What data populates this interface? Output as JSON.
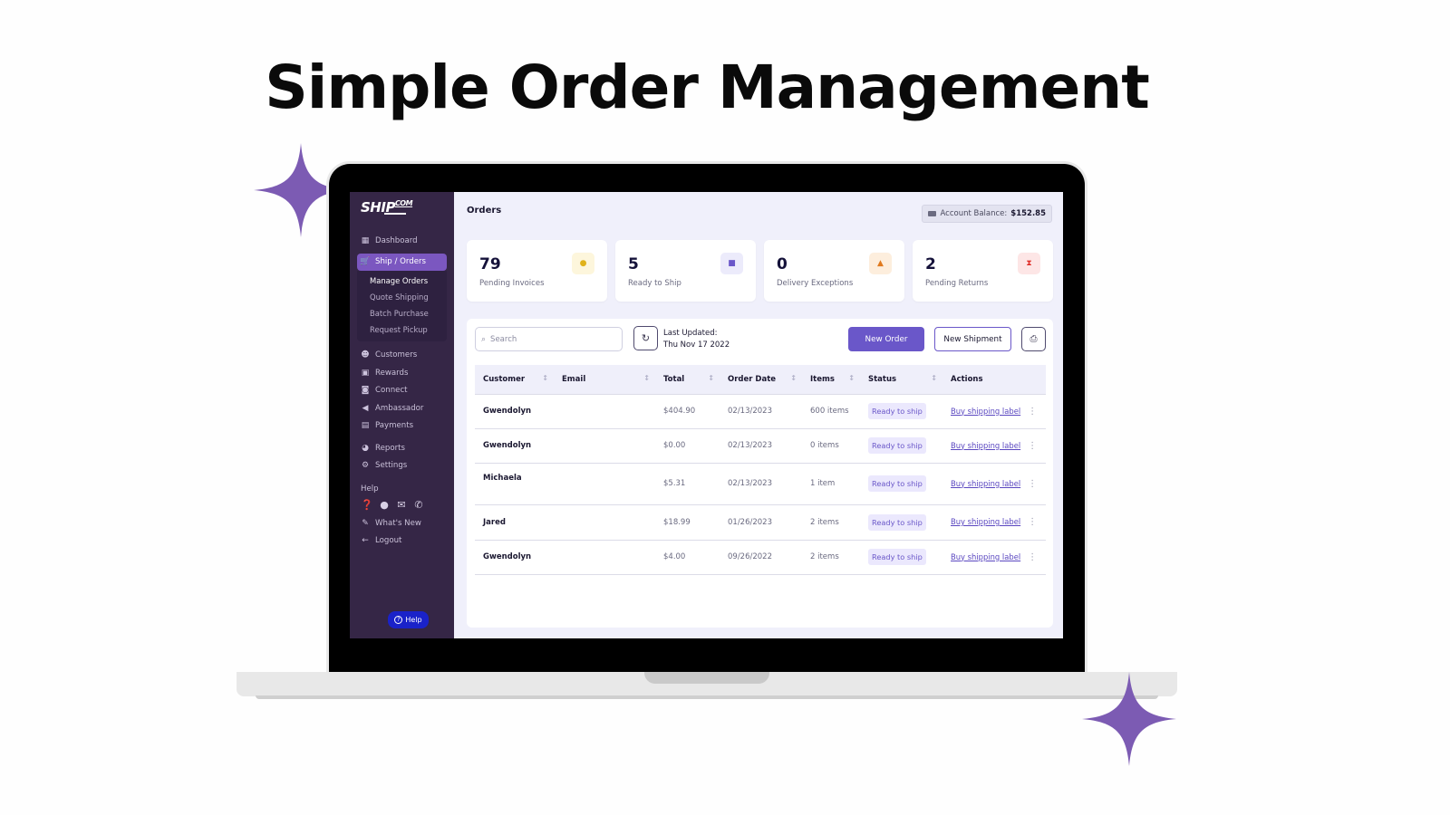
{
  "hero": {
    "title": "Simple Order Management"
  },
  "colors": {
    "accent": "#6a57c9",
    "sidebar_bg": "#352646",
    "sparkle": "#7c5bb3",
    "help_button": "#1a22c9"
  },
  "sidebar": {
    "logo": {
      "main": "SHIP",
      "sub": "COM"
    },
    "items": [
      {
        "label": "Dashboard",
        "icon": "grid-icon",
        "glyph": "▦"
      },
      {
        "label": "Ship / Orders",
        "icon": "cart-icon",
        "glyph": "🛒",
        "active": true
      },
      {
        "label": "Customers",
        "icon": "users-icon",
        "glyph": "👥"
      },
      {
        "label": "Rewards",
        "icon": "gift-icon",
        "glyph": "🎁"
      },
      {
        "label": "Connect",
        "icon": "chat-icon",
        "glyph": "💬"
      },
      {
        "label": "Ambassador",
        "icon": "megaphone-icon",
        "glyph": "📣"
      },
      {
        "label": "Payments",
        "icon": "money-icon",
        "glyph": "💵"
      },
      {
        "label": "Reports",
        "icon": "pie-chart-icon",
        "glyph": "◕"
      },
      {
        "label": "Settings",
        "icon": "gear-icon",
        "glyph": "⚙"
      }
    ],
    "subitems": [
      {
        "label": "Manage Orders",
        "current": true
      },
      {
        "label": "Quote Shipping"
      },
      {
        "label": "Batch Purchase"
      },
      {
        "label": "Request Pickup"
      }
    ],
    "help_heading": "Help",
    "help_icons": [
      {
        "name": "question-icon",
        "glyph": "❓"
      },
      {
        "name": "chat-bubble-icon",
        "glyph": "💬"
      },
      {
        "name": "envelope-icon",
        "glyph": "✉"
      },
      {
        "name": "phone-icon",
        "glyph": "✆"
      }
    ],
    "whats_new": {
      "label": "What's New",
      "glyph": "✎"
    },
    "logout": {
      "label": "Logout",
      "glyph": "←"
    },
    "help_button": "Help"
  },
  "header": {
    "title": "Orders",
    "balance_label": "Account Balance:",
    "balance_value": "$152.85"
  },
  "stats": [
    {
      "value": "79",
      "label": "Pending Invoices",
      "icon": "clock-icon",
      "glyph": "●",
      "bg": "#fdf6dc",
      "fg": "#e0b21a"
    },
    {
      "value": "5",
      "label": "Ready to Ship",
      "icon": "cart-icon",
      "glyph": "🛒",
      "bg": "#ecebfb",
      "fg": "#6a57c9"
    },
    {
      "value": "0",
      "label": "Delivery Exceptions",
      "icon": "warning-icon",
      "glyph": "▲",
      "bg": "#fdeedd",
      "fg": "#e07a1f"
    },
    {
      "value": "2",
      "label": "Pending Returns",
      "icon": "hourglass-icon",
      "glyph": "⧗",
      "bg": "#fde6e6",
      "fg": "#e0352f"
    }
  ],
  "toolbar": {
    "search_placeholder": "Search",
    "last_updated_label": "Last Updated:",
    "last_updated_value": "Thu Nov 17 2022",
    "new_order": "New Order",
    "new_shipment": "New Shipment"
  },
  "table": {
    "columns": [
      "Customer",
      "Email",
      "Total",
      "Order Date",
      "Items",
      "Status",
      "Actions"
    ],
    "rows": [
      {
        "customer": "Gwendolyn",
        "email": "",
        "total": "$404.90",
        "date": "02/13/2023",
        "items": "600 items",
        "status": "Ready to ship",
        "action": "Buy shipping label"
      },
      {
        "customer": "Gwendolyn",
        "email": "",
        "total": "$0.00",
        "date": "02/13/2023",
        "items": "0 items",
        "status": "Ready to ship",
        "action": "Buy shipping label"
      },
      {
        "customer": "Michaela",
        "email": "",
        "total": "$5.31",
        "date": "02/13/2023",
        "items": "1 item",
        "status": "Ready to ship",
        "action": "Buy shipping label"
      },
      {
        "customer": "Jared",
        "email": "",
        "total": "$18.99",
        "date": "01/26/2023",
        "items": "2 items",
        "status": "Ready to ship",
        "action": "Buy shipping label"
      },
      {
        "customer": "Gwendolyn",
        "email": "",
        "total": "$4.00",
        "date": "09/26/2022",
        "items": "2 items",
        "status": "Ready to ship",
        "action": "Buy shipping label"
      }
    ]
  }
}
